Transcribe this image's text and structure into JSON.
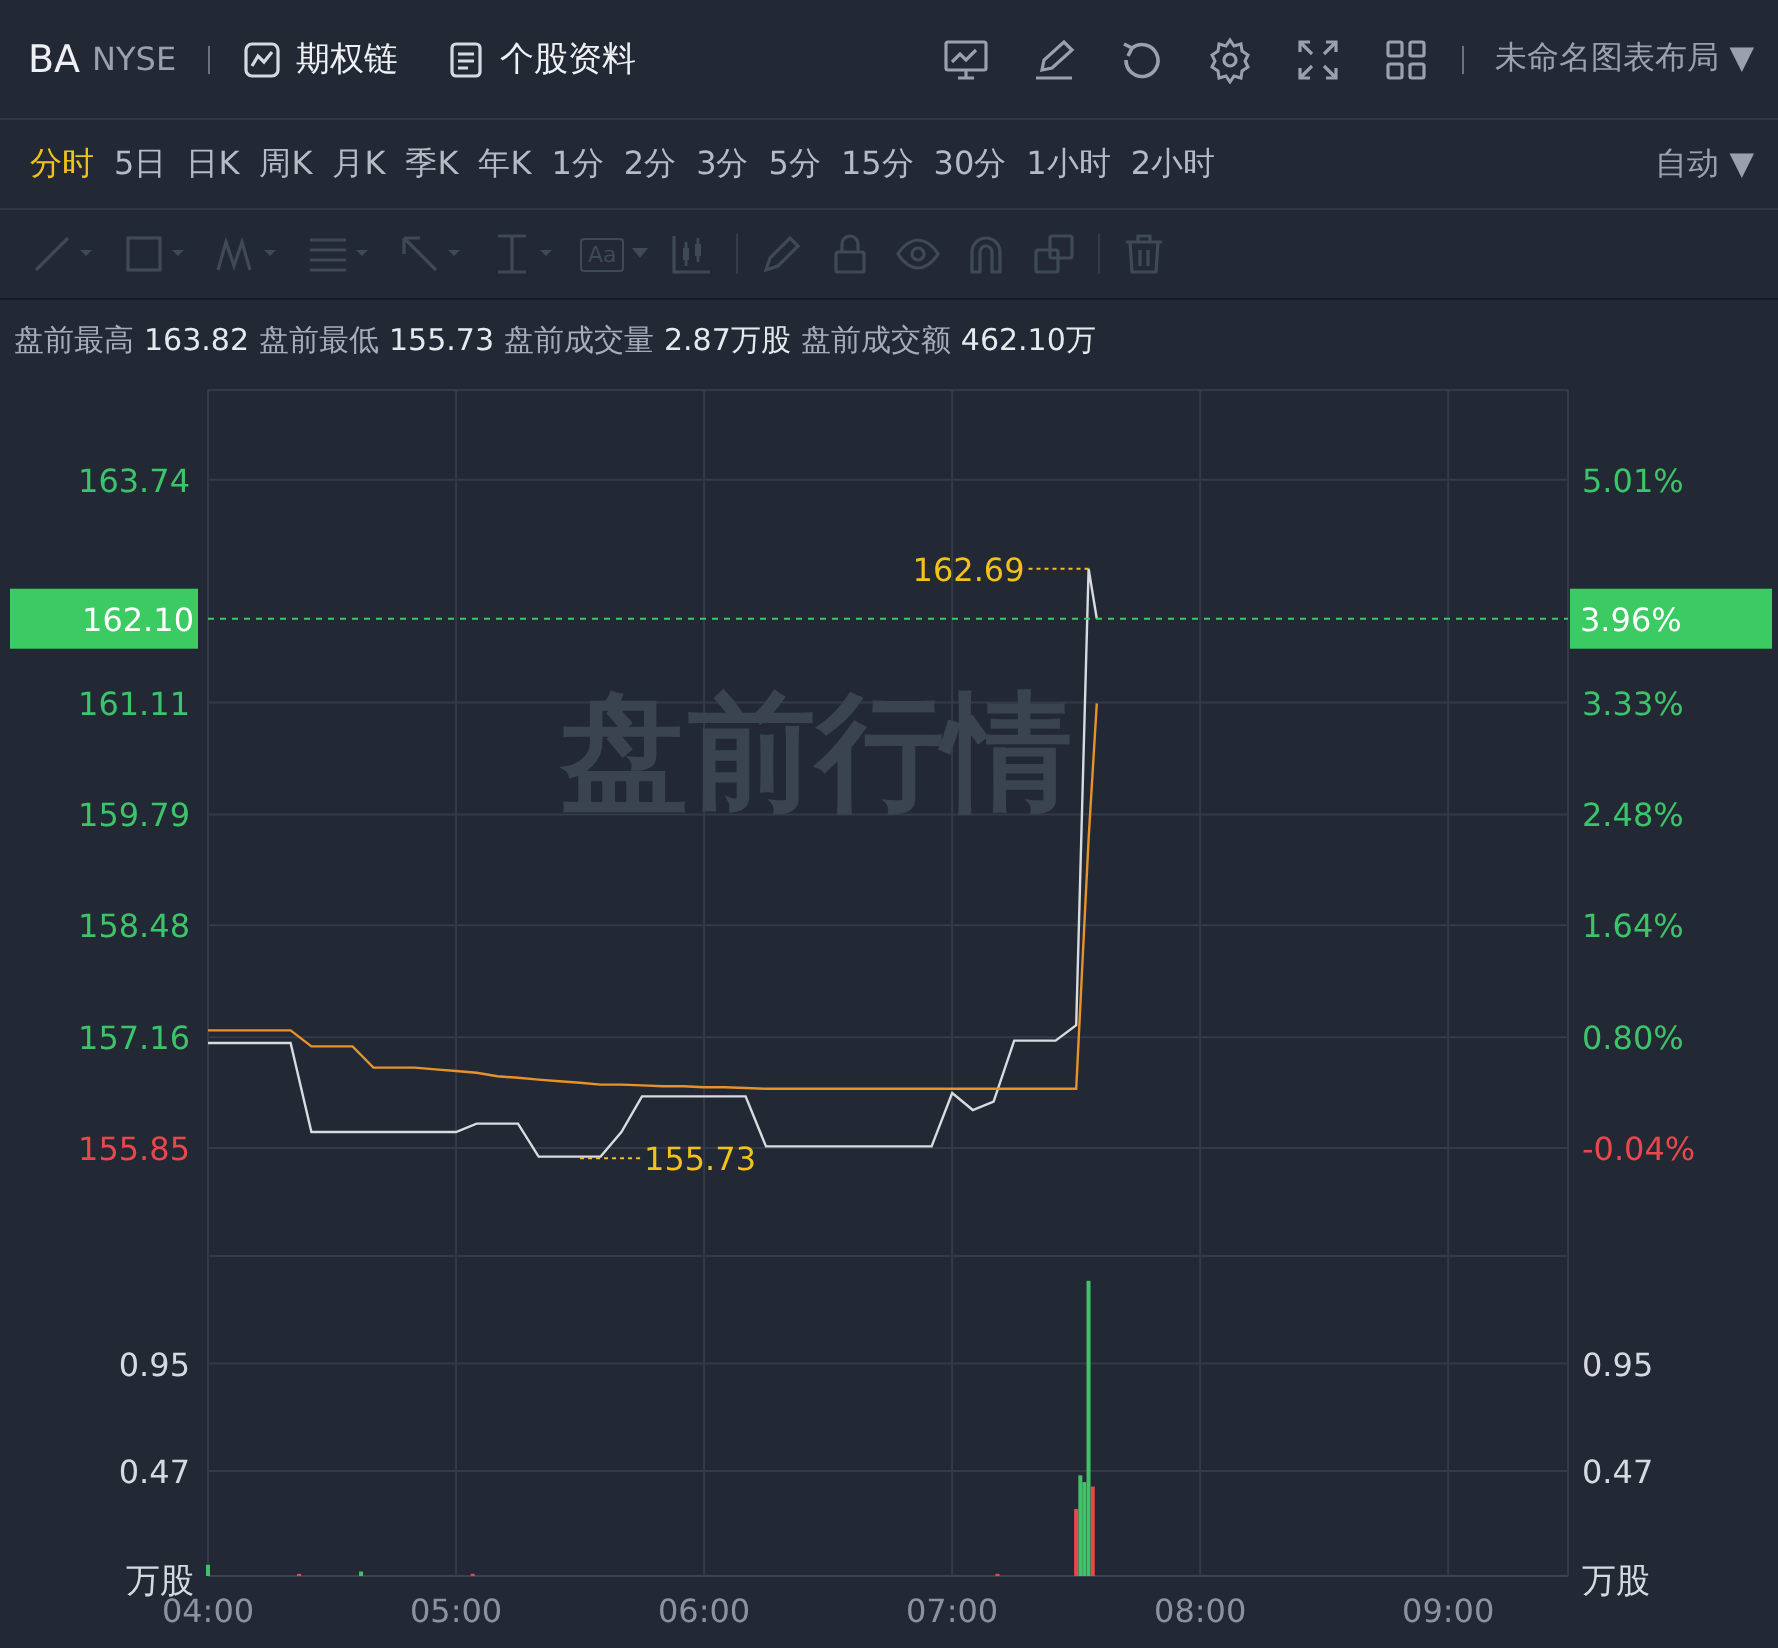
{
  "header": {
    "symbol": "BA",
    "exchange": "NYSE",
    "links": [
      {
        "label": "期权链"
      },
      {
        "label": "个股资料"
      }
    ],
    "layout_menu": {
      "label": "未命名图表布局",
      "caret": "▼"
    }
  },
  "periods": [
    {
      "label": "分时",
      "selected": true
    },
    {
      "label": "5日",
      "selected": false
    },
    {
      "label": "日K",
      "selected": false
    },
    {
      "label": "周K",
      "selected": false
    },
    {
      "label": "月K",
      "selected": false
    },
    {
      "label": "季K",
      "selected": false
    },
    {
      "label": "年K",
      "selected": false
    },
    {
      "label": "1分",
      "selected": false
    },
    {
      "label": "2分",
      "selected": false
    },
    {
      "label": "3分",
      "selected": false
    },
    {
      "label": "5分",
      "selected": false
    },
    {
      "label": "15分",
      "selected": false
    },
    {
      "label": "30分",
      "selected": false
    },
    {
      "label": "1小时",
      "selected": false
    },
    {
      "label": "2小时",
      "selected": false
    }
  ],
  "scale_menu": {
    "label": "自动",
    "caret": "▼"
  },
  "drawing_toolbar": {
    "disabled": true,
    "text_tool_label": "Aa"
  },
  "stats": [
    {
      "label": "盘前最高",
      "value": "163.82"
    },
    {
      "label": "盘前最低",
      "value": "155.73"
    },
    {
      "label": "盘前成交量",
      "value": "2.87万股"
    },
    {
      "label": "盘前成交额",
      "value": "462.10万"
    }
  ],
  "price_chart": {
    "watermark": "盘前行情",
    "current_price": {
      "price": "162.10",
      "percent": "3.96%"
    },
    "percent_axis": [
      {
        "label": "5.01%",
        "color": "#3cc46a"
      },
      {
        "label": "3.33%",
        "color": "#3cc46a"
      },
      {
        "label": "2.48%",
        "color": "#3cc46a"
      },
      {
        "label": "1.64%",
        "color": "#3cc46a"
      },
      {
        "label": "0.80%",
        "color": "#3cc46a"
      },
      {
        "label": "-0.04%",
        "color": "#e8474c"
      }
    ],
    "chart_data": {
      "type": "line",
      "x": [
        4,
        4.083,
        4.167,
        4.25,
        4.333,
        4.417,
        4.5,
        4.583,
        4.667,
        4.75,
        4.833,
        4.917,
        5,
        5.083,
        5.167,
        5.25,
        5.333,
        5.417,
        5.5,
        5.583,
        5.667,
        5.75,
        5.833,
        5.917,
        6,
        6.083,
        6.167,
        6.25,
        6.333,
        6.417,
        6.5,
        6.583,
        6.667,
        6.75,
        6.833,
        6.917,
        7,
        7.083,
        7.167,
        7.25,
        7.333,
        7.417,
        7.5,
        7.55,
        7.583
      ],
      "grid": true,
      "ref_lines": [
        {
          "axis": "y",
          "value": 162.1
        }
      ],
      "series": [
        {
          "color": "#d8dbe0",
          "values": [
            157.09,
            157.09,
            157.09,
            157.09,
            157.09,
            156.04,
            156.04,
            156.04,
            156.04,
            156.04,
            156.04,
            156.04,
            156.04,
            156.14,
            156.14,
            156.14,
            155.75,
            155.75,
            155.75,
            155.75,
            156.04,
            156.46,
            156.46,
            156.46,
            156.46,
            156.46,
            156.46,
            155.87,
            155.87,
            155.87,
            155.87,
            155.87,
            155.87,
            155.87,
            155.87,
            155.87,
            156.5,
            156.3,
            156.4,
            157.12,
            157.12,
            157.12,
            157.3,
            162.69,
            162.1
          ]
        },
        {
          "color": "#e8922a",
          "values": [
            157.24,
            157.24,
            157.24,
            157.24,
            157.24,
            157.05,
            157.05,
            157.05,
            156.8,
            156.8,
            156.8,
            156.78,
            156.76,
            156.74,
            156.7,
            156.68,
            156.66,
            156.64,
            156.62,
            156.6,
            156.6,
            156.59,
            156.58,
            156.58,
            156.57,
            156.57,
            156.56,
            156.55,
            156.55,
            156.55,
            156.55,
            156.55,
            156.55,
            156.55,
            156.55,
            156.55,
            156.55,
            156.55,
            156.55,
            156.55,
            156.55,
            156.55,
            156.55,
            159.5,
            161.1
          ]
        }
      ],
      "xlim": [
        4,
        9.483
      ],
      "ylim": [
        154.6,
        164.8
      ],
      "yticks": [
        {
          "value": 163.74,
          "label": "163.74"
        },
        {
          "value": 161.11,
          "label": "161.11"
        },
        {
          "value": 159.79,
          "label": "159.79"
        },
        {
          "value": 158.48,
          "label": "158.48"
        },
        {
          "value": 157.16,
          "label": "157.16"
        },
        {
          "value": 155.85,
          "label": "155.85"
        }
      ],
      "annotations": [
        {
          "x": 7.55,
          "y": 162.69,
          "text": "162.69"
        },
        {
          "x": 5.5,
          "y": 155.73,
          "text": "155.73"
        }
      ]
    }
  },
  "volume_chart": {
    "unit_labels": [
      "万股",
      "万股"
    ],
    "right_ticks": [
      "0.95",
      "0.47"
    ],
    "chart_data": {
      "type": "bar",
      "x": [
        4,
        4.367,
        4.617,
        5.067,
        7.183,
        7.5,
        7.517,
        7.533,
        7.55,
        7.567
      ],
      "series": [
        {
          "color": "#3cc46a",
          "values": [
            0.05,
            null,
            0.02,
            null,
            null,
            null,
            0.45,
            0.42,
            1.32,
            null
          ]
        },
        {
          "color": "#e8474c",
          "values": [
            null,
            0.01,
            null,
            0.01,
            0.01,
            0.3,
            null,
            null,
            null,
            0.4
          ]
        }
      ],
      "xlim": [
        4,
        9.483
      ],
      "ylim": [
        0,
        1.44
      ],
      "grid": true,
      "yticks": [
        {
          "value": 0.95,
          "label": "0.95"
        },
        {
          "value": 0.47,
          "label": "0.47"
        }
      ],
      "xticks": [
        {
          "value": 4,
          "label": "04:00"
        },
        {
          "value": 5,
          "label": "05:00"
        },
        {
          "value": 6,
          "label": "06:00"
        },
        {
          "value": 7,
          "label": "07:00"
        },
        {
          "value": 8,
          "label": "08:00"
        },
        {
          "value": 9,
          "label": "09:00"
        }
      ]
    }
  }
}
